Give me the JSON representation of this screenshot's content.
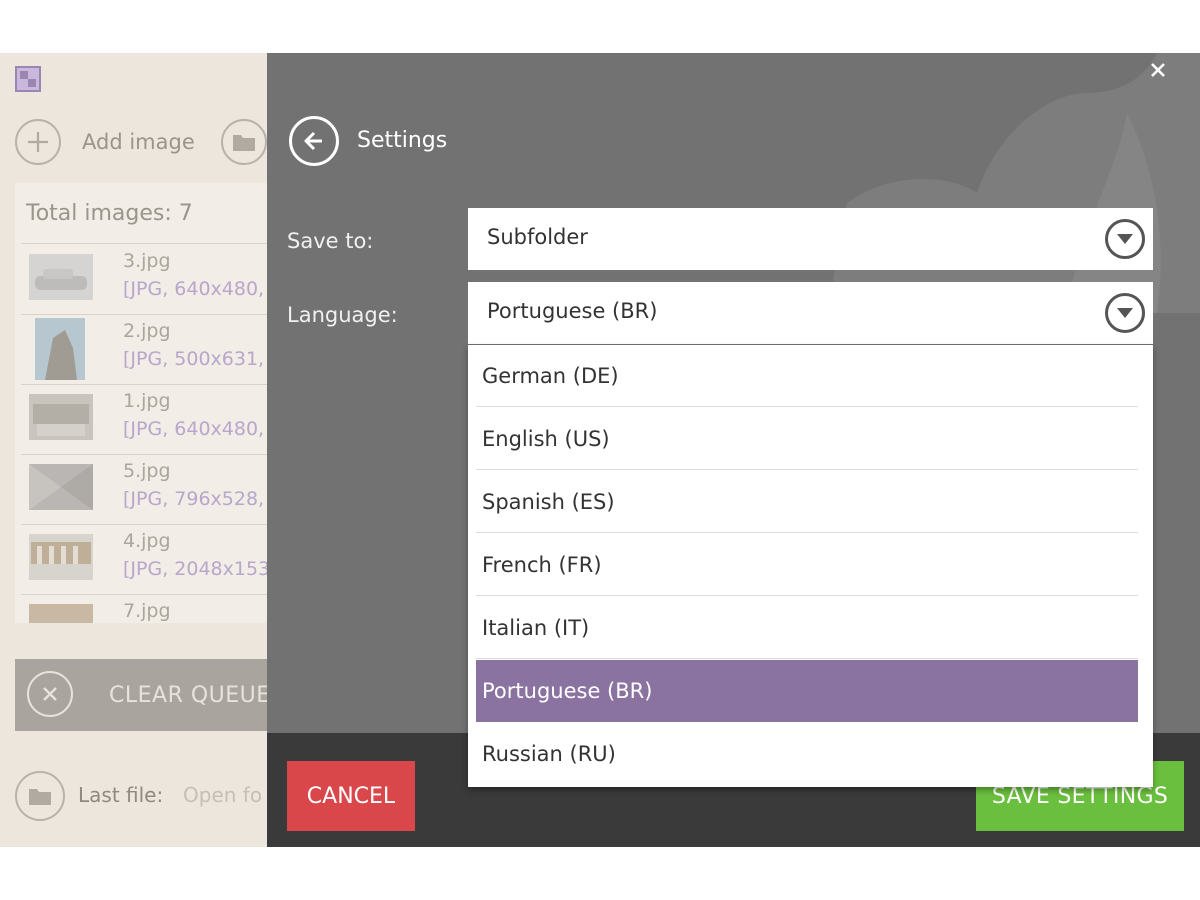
{
  "left_panel": {
    "add_image_label": "Add image",
    "total_images": "Total images: 7",
    "files": [
      {
        "name": "3.jpg",
        "meta": "[JPG, 640x480,"
      },
      {
        "name": "2.jpg",
        "meta": "[JPG, 500x631,"
      },
      {
        "name": "1.jpg",
        "meta": "[JPG, 640x480,"
      },
      {
        "name": "5.jpg",
        "meta": "[JPG, 796x528,"
      },
      {
        "name": "4.jpg",
        "meta": "[JPG, 2048x153"
      },
      {
        "name": "7.jpg",
        "meta": ""
      }
    ],
    "clear_queue_label": "CLEAR QUEUE",
    "last_file_label": "Last file:",
    "open_folder_link": "Open fo"
  },
  "settings": {
    "title": "Settings",
    "save_to": {
      "label": "Save to:",
      "value": "Subfolder"
    },
    "language": {
      "label": "Language:",
      "value": "Portuguese (BR)",
      "options": [
        "German (DE)",
        "English (US)",
        "Spanish (ES)",
        "French (FR)",
        "Italian (IT)",
        "Portuguese (BR)",
        "Russian (RU)"
      ],
      "highlighted": "Portuguese (BR)"
    },
    "cancel_label": "CANCEL",
    "save_label": "SAVE SETTINGS"
  },
  "colors": {
    "accent_purple": "#8a73a0",
    "cancel_red": "#d9474a",
    "save_green": "#6bbf3e",
    "overlay_gray": "#727272"
  },
  "icons": [
    "app-logo-icon",
    "add-icon",
    "folder-icon",
    "clear-icon",
    "back-arrow-icon",
    "close-icon",
    "dropdown-arrow-icon"
  ]
}
